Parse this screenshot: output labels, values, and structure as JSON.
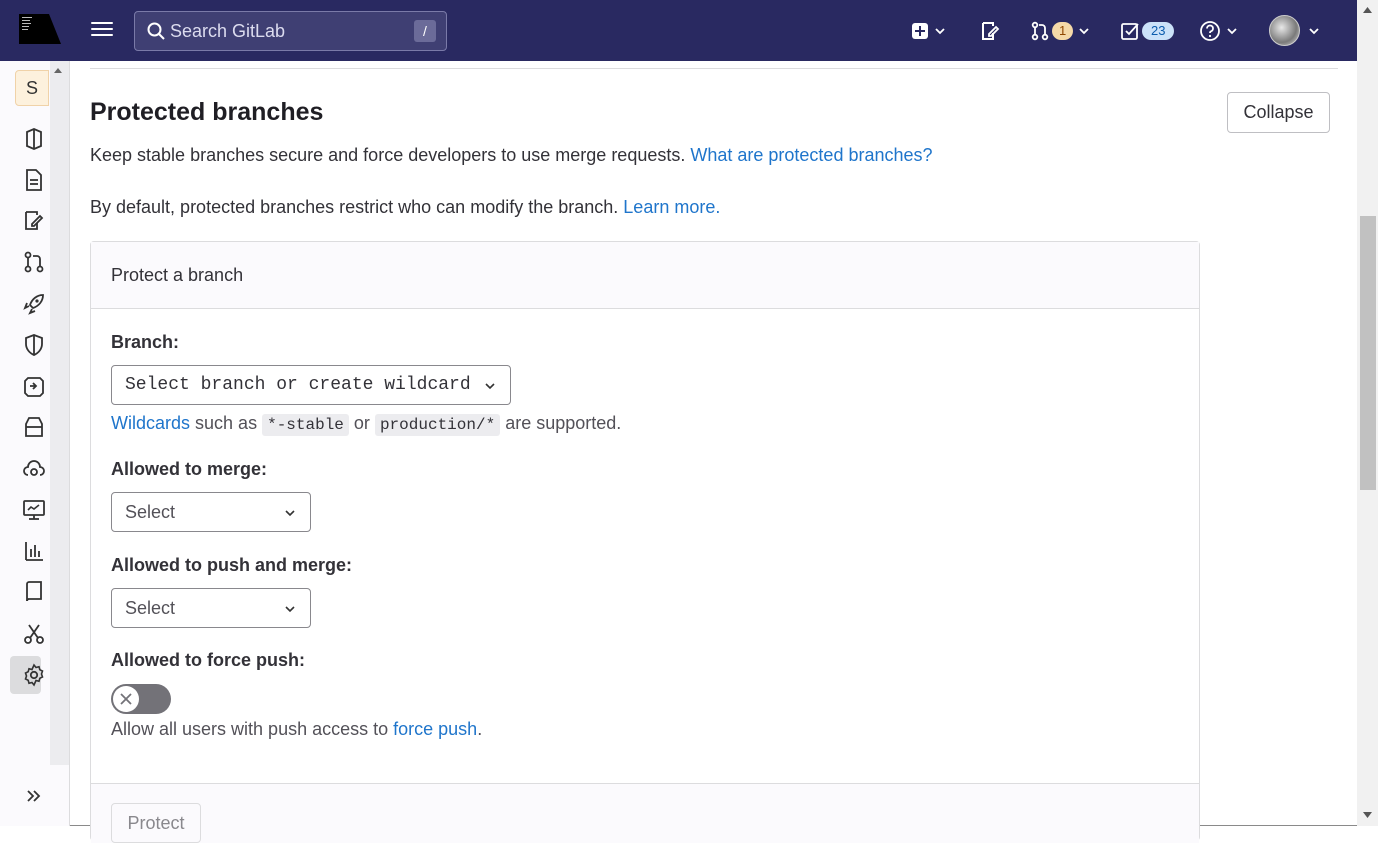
{
  "header": {
    "search_placeholder": "Search GitLab",
    "search_shortcut": "/",
    "merge_requests_count": "1",
    "todos_count": "23"
  },
  "sidebar": {
    "project_initial": "S",
    "items": [
      "project-icon",
      "issues-icon",
      "code-icon",
      "merge-request-icon",
      "deploy-rocket-icon",
      "shield-icon",
      "ci-cd-icon",
      "package-icon",
      "infrastructure-icon",
      "monitor-icon",
      "analytics-icon",
      "wiki-book-icon",
      "snippets-scissors-icon",
      "settings-gear-icon"
    ]
  },
  "section": {
    "title": "Protected branches",
    "collapse_label": "Collapse",
    "description": "Keep stable branches secure and force developers to use merge requests.",
    "description_link": "What are protected branches?",
    "default_text": "By default, protected branches restrict who can modify the branch.",
    "default_link": "Learn more."
  },
  "form": {
    "card_title": "Protect a branch",
    "branch_label": "Branch:",
    "branch_dropdown": "Select branch or create wildcard",
    "wildcard_link": "Wildcards",
    "wildcard_text_1": "such as",
    "wildcard_code_1": "*-stable",
    "wildcard_text_2": "or",
    "wildcard_code_2": "production/*",
    "wildcard_text_3": "are supported.",
    "merge_label": "Allowed to merge:",
    "merge_select": "Select",
    "push_label": "Allowed to push and merge:",
    "push_select": "Select",
    "force_label": "Allowed to force push:",
    "force_help": "Allow all users with push access to",
    "force_link": "force push",
    "force_period": ".",
    "force_enabled": false,
    "protect_button": "Protect"
  }
}
